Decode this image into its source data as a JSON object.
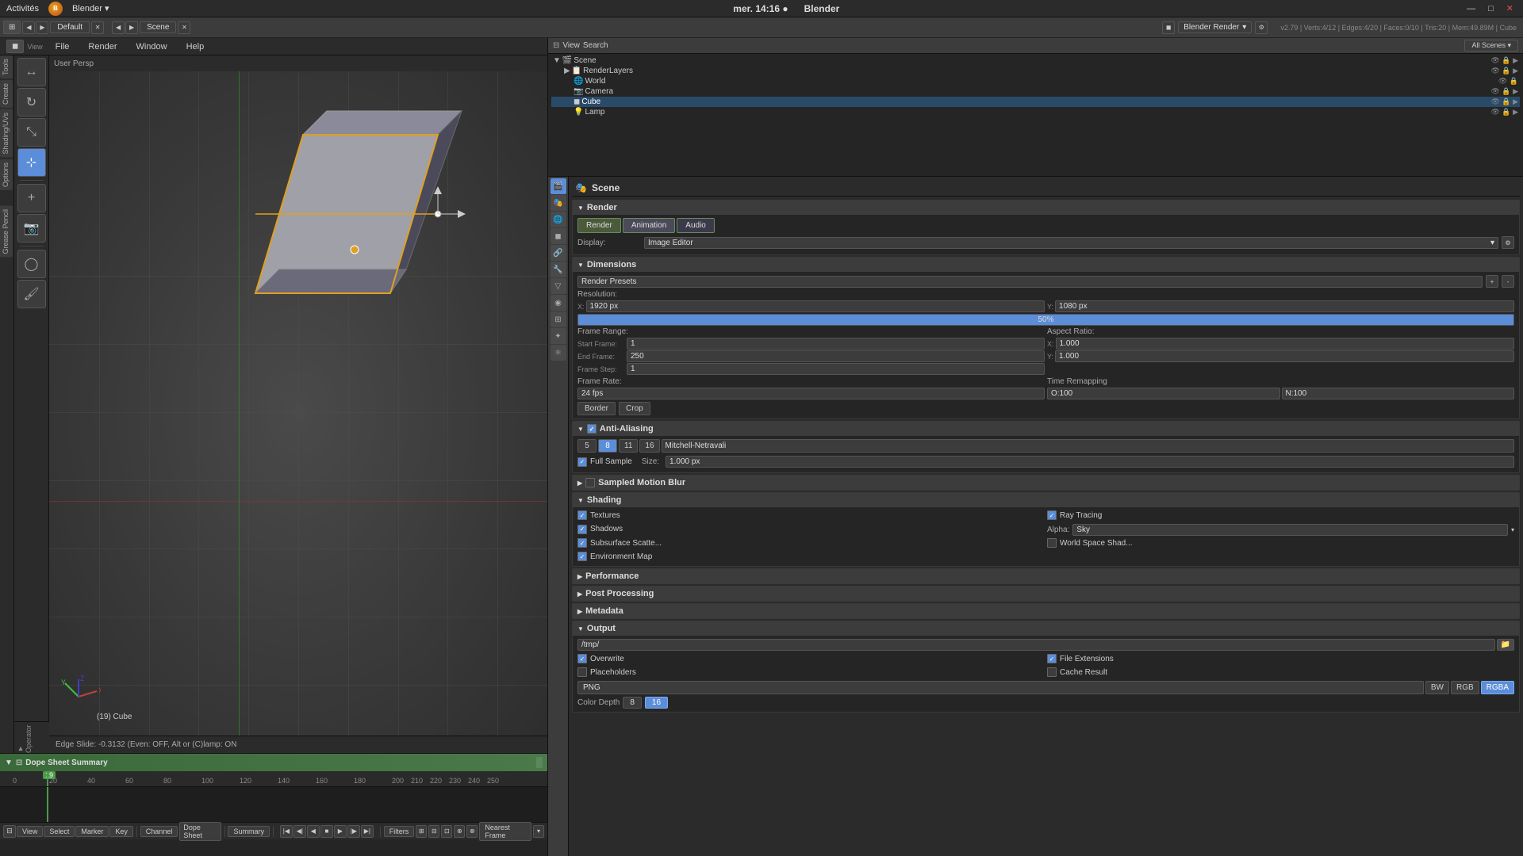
{
  "topbar": {
    "app_name": "Blender",
    "title": "Blender",
    "datetime": "mer. 14:16 ●",
    "window_controls": [
      "—",
      "□",
      "✕"
    ]
  },
  "menubar": {
    "items": [
      "Activités",
      "Blender ▾",
      "File",
      "Render",
      "Window",
      "Help"
    ],
    "workspace": "Default",
    "scene_name": "Scene",
    "engine": "Blender Render",
    "version_info": "v2.79 | Verts:4/12 | Edges:4/20 | Faces:0/10 | Tris:20 | Mem:49.89M | Cube"
  },
  "viewport": {
    "header": "User Persp",
    "object_name": "(19) Cube",
    "status_text": "Edge Slide: -0.3132 (Even: OFF, Alt or (C)lamp: ON"
  },
  "outliner": {
    "title": "Scene",
    "items": [
      {
        "name": "Scene",
        "type": "scene",
        "indent": 0
      },
      {
        "name": "RenderLayers",
        "type": "renderlayers",
        "indent": 1
      },
      {
        "name": "World",
        "type": "world",
        "indent": 1
      },
      {
        "name": "Camera",
        "type": "camera",
        "indent": 1
      },
      {
        "name": "Cube",
        "type": "cube",
        "indent": 1
      },
      {
        "name": "Lamp",
        "type": "lamp",
        "indent": 1
      }
    ]
  },
  "properties": {
    "scene_label": "Scene",
    "sections": {
      "render": {
        "title": "Render",
        "buttons": {
          "render": "Render",
          "animation": "Animation",
          "audio": "Audio"
        },
        "display_label": "Display:",
        "display_value": "Image Editor",
        "dimensions": {
          "title": "Dimensions",
          "presets_label": "Render Presets",
          "resolution": {
            "label": "Resolution:",
            "x": "1920 px",
            "y": "1080 px",
            "percent": "50%"
          },
          "frame_range": {
            "label": "Frame Range:",
            "start_label": "Start Frame:",
            "start": "1",
            "end_label": "End Frame:",
            "end": "250",
            "step_label": "Frame Step:",
            "step": "1"
          },
          "aspect_ratio": {
            "label": "Aspect Ratio:",
            "x": "1.000",
            "y": "1.000"
          },
          "frame_rate": {
            "label": "Frame Rate:",
            "value": "24 fps"
          },
          "time_remapping": {
            "label": "Time Remapping",
            "o": "O:100",
            "n": "N:100"
          },
          "border_label": "Border",
          "crop_label": "Crop"
        },
        "anti_aliasing": {
          "title": "Anti-Aliasing",
          "values": [
            "5",
            "8",
            "11",
            "16"
          ],
          "active": "8",
          "algorithm": "Mitchell-Netravali",
          "full_sample_label": "Full Sample",
          "size_label": "Size:",
          "size_value": "1.000 px"
        },
        "sampled_motion_blur": {
          "title": "Sampled Motion Blur"
        },
        "shading": {
          "title": "Shading",
          "textures": "Textures",
          "ray_tracing": "Ray Tracing",
          "shadows": "Shadows",
          "alpha_label": "Alpha:",
          "alpha_value": "Sky",
          "subsurface_scatter": "Subsurface Scatte...",
          "world_space_shad": "World Space Shad...",
          "environment_map": "Environment Map"
        },
        "performance": {
          "title": "Performance"
        },
        "post_processing": {
          "title": "Post Processing"
        },
        "metadata": {
          "title": "Metadata"
        },
        "output": {
          "title": "Output",
          "path": "/tmp/",
          "overwrite": "Overwrite",
          "file_extensions": "File Extensions",
          "placeholders": "Placeholders",
          "cache_result": "Cache Result",
          "format_png": "PNG",
          "format_bw": "BW",
          "format_rgb": "RGB",
          "format_rgba": "RGBA",
          "color_depth_label": "Color Depth",
          "color_depth_value": "8",
          "color_depth_extra": "16"
        }
      }
    }
  },
  "timeline": {
    "title": "Dope Sheet Summary",
    "current_frame": "19",
    "footer": {
      "view": "View",
      "select": "Select",
      "marker": "Marker",
      "key": "Key",
      "channel": "Channel",
      "dope_sheet": "Dope Sheet",
      "summary": "Summary",
      "filters": "Filters",
      "nearest_frame": "Nearest Frame"
    },
    "ruler_marks": [
      "0",
      "20",
      "40",
      "60",
      "80",
      "100",
      "120",
      "140",
      "160",
      "180",
      "200",
      "210",
      "220",
      "230",
      "240",
      "250"
    ]
  },
  "toolbar_tabs": [
    "Tools",
    "Create",
    "Shading/UVs",
    "Options"
  ],
  "left_tools": [
    "🔧",
    "✏️",
    "🔄",
    "📐",
    "🎨",
    "⭕"
  ],
  "icons": {
    "scene": "🎬",
    "world": "🌐",
    "camera": "📷",
    "cube": "◼",
    "lamp": "💡",
    "render_layers": "📋",
    "arrow_right": "▶",
    "arrow_down": "▼",
    "arrow_left": "◀",
    "check": "✓",
    "folder": "📁"
  }
}
